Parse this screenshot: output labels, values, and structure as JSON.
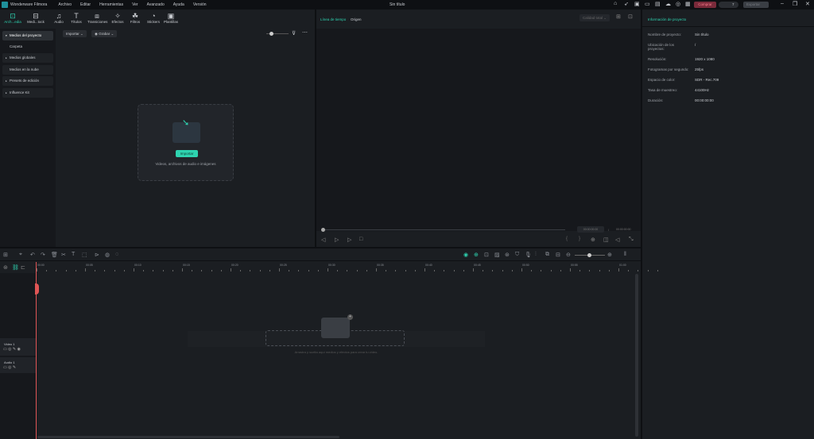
{
  "app": {
    "name": "Wonderware Filmora",
    "title": "Sin título",
    "menu": [
      "Archivo",
      "Editar",
      "Herramientas",
      "Ver",
      "Avanzado",
      "Ayuda",
      "Versión"
    ],
    "buy": "Comprar",
    "export": "Exportar",
    "credits": "7"
  },
  "toolbar": [
    {
      "label": "Arch...edia",
      "icon": "media-icon"
    },
    {
      "label": "Medi...tock",
      "icon": "stock-icon"
    },
    {
      "label": "Audio",
      "icon": "music-icon"
    },
    {
      "label": "Títulos",
      "icon": "title-icon"
    },
    {
      "label": "Transiciones",
      "icon": "transition-icon"
    },
    {
      "label": "Efectos",
      "icon": "effects-icon"
    },
    {
      "label": "Filtros",
      "icon": "filter-icon"
    },
    {
      "label": "Stickers",
      "icon": "sticker-icon"
    },
    {
      "label": "Plantillas",
      "icon": "template-icon"
    }
  ],
  "leftnav": [
    "Medios del proyecto",
    "Carpeta",
    "Medios globales",
    "Medios en la nube",
    "Presets de edición",
    "Influence Kit"
  ],
  "media": {
    "import": "Importar",
    "record": "Grabar",
    "drop_button": "Importar",
    "drop_hint": "Videos, archivos de audio e imágenes"
  },
  "player": {
    "tabs": [
      "Línea de tiempo",
      "Origen"
    ],
    "quality": "Calidad total",
    "current": "00:00:00:00",
    "total": "00:00:00:00"
  },
  "info": {
    "title": "Información de proyecto",
    "rows": [
      {
        "k": "Nombre de proyecto:",
        "v": "Sin título"
      },
      {
        "k": "Ubicación de los proyectos:",
        "v": "/"
      },
      {
        "k": "Resolución:",
        "v": "1920 x 1080"
      },
      {
        "k": "Fotogramas por segundo:",
        "v": "25fps"
      },
      {
        "k": "Espacio de color:",
        "v": "SDR - Rec.709"
      },
      {
        "k": "Tasa de muestreo:",
        "v": "44100Hz"
      },
      {
        "k": "Duración:",
        "v": "00:00:00:00"
      }
    ]
  },
  "timeline": {
    "ticks": [
      "00:00",
      "00:05",
      "00:10",
      "00:15",
      "00:20",
      "00:25",
      "00:30",
      "00:35",
      "00:40",
      "00:45",
      "00:50",
      "00:55",
      "01:00"
    ],
    "tracks": [
      "Video 1",
      "Audio 1"
    ],
    "hint": "Arrastra y suelta aquí medios y efectos para crear tu video."
  }
}
